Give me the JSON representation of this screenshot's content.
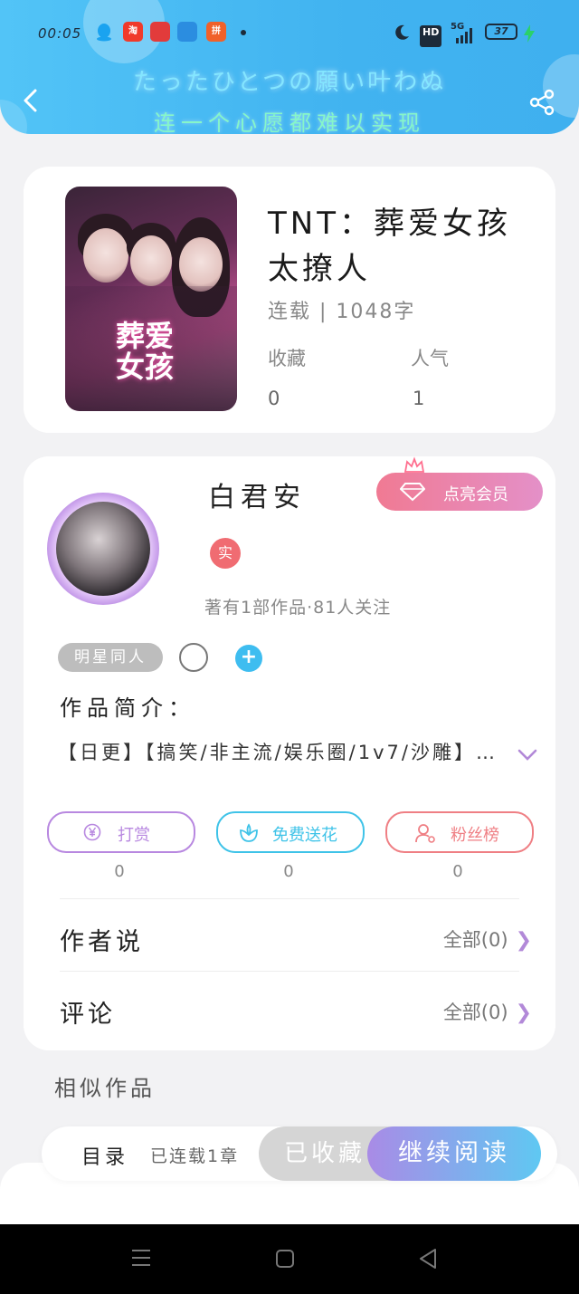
{
  "status_bar": {
    "time": "00:05",
    "app_icons": [
      "qq-icon",
      "taobao-icon",
      "618-icon",
      "app-icon",
      "pinduoduo-icon"
    ],
    "taobao_text": "淘",
    "pdd_text": "拼",
    "hd": "HD",
    "network": "5G",
    "battery": "37"
  },
  "header": {
    "banner_line1": "たったひとつの願い叶わぬ",
    "banner_line2": "连一个心愿都难以实现"
  },
  "book": {
    "title": "TNT：葬爱女孩太撩人",
    "status": "连载 | 1048字",
    "stats": [
      {
        "label": "收藏",
        "value": "0"
      },
      {
        "label": "人气",
        "value": "1"
      }
    ],
    "cover_text": "葬爱女孩"
  },
  "author": {
    "name": "白君安",
    "vip_label": "点亮会员",
    "badge": "实",
    "stats": "著有1部作品·81人关注",
    "tag": "明星同人",
    "intro_label": "作品简介：",
    "intro_text": "【日更】【搞笑/非主流/娱乐圈/1v7/沙雕】…"
  },
  "actions": [
    {
      "label": "打赏",
      "value": "0",
      "color": "#b888e0"
    },
    {
      "label": "免费送花",
      "value": "0",
      "color": "#3fc3e8"
    },
    {
      "label": "粉丝榜",
      "value": "0",
      "color": "#ef7f84"
    }
  ],
  "rows": {
    "author_says": {
      "title": "作者说",
      "link": "全部(0)"
    },
    "comments": {
      "title": "评论",
      "link": "全部(0)"
    }
  },
  "similar_label": "相似作品",
  "bottom": {
    "toc": "目录",
    "serial": "已连载1章",
    "collected": "已收藏",
    "continue": "继续阅读"
  }
}
